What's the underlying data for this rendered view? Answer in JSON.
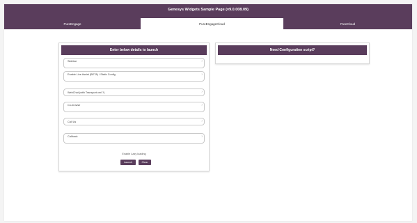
{
  "header": {
    "title": "Genesys Widgets Sample Page (v9.0.008.09)",
    "tabs": [
      {
        "label": "PureEngage"
      },
      {
        "label": "PureEngageCloud"
      },
      {
        "label": "PureCloud"
      }
    ]
  },
  "launch_panel": {
    "title": "Enter below details to launch",
    "fields": [
      {
        "label": "Sidebar"
      },
      {
        "label": "Enable Live Assist (BETA) / Static Config"
      },
      {
        "label": "WebChat (with Transport.xml ?)"
      },
      {
        "label": "Co-browse"
      },
      {
        "label": "Call Us"
      },
      {
        "label": "Callback"
      }
    ],
    "lazy_loading_label": "Enable Lazy loading",
    "launch_label": "Launch",
    "close_label": "Clear"
  },
  "config_panel": {
    "title": "Need Configuration script?"
  },
  "colors": {
    "brand": "#5a3d5c",
    "page_bg": "#f4f4f4"
  }
}
